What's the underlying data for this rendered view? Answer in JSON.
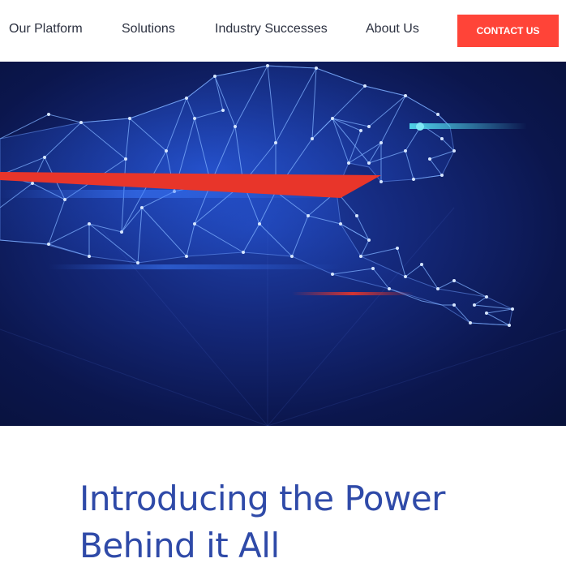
{
  "nav": {
    "items": [
      {
        "label": "Our Platform"
      },
      {
        "label": "Solutions"
      },
      {
        "label": "Industry Successes"
      },
      {
        "label": "About Us"
      }
    ],
    "cta_label": "CONTACT US"
  },
  "hero": {
    "image": "low-poly-cheetah-illustration"
  },
  "intro": {
    "heading": "Introducing the Power Behind it All"
  },
  "colors": {
    "cta": "#ff4438",
    "heading": "#2f4aa8",
    "nav_text": "#2c3140",
    "hero_background": "#0b164d",
    "accent_red": "#e8352a",
    "accent_cyan": "#4fd1e6"
  }
}
